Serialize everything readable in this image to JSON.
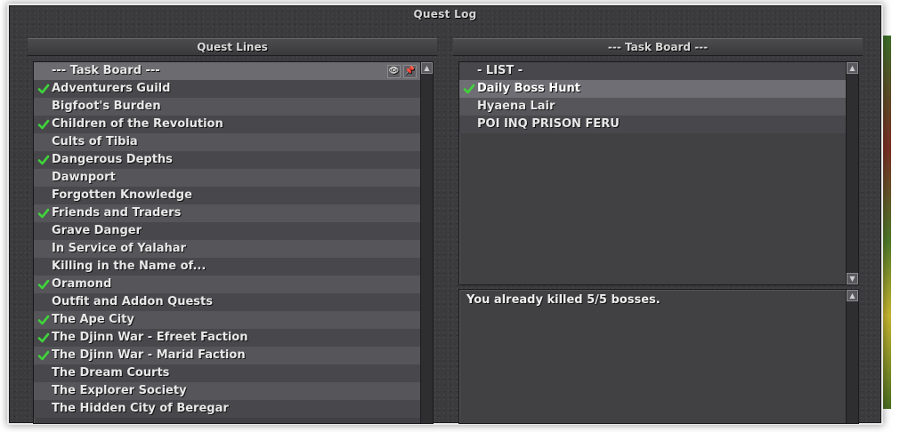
{
  "window": {
    "title": "Quest Log"
  },
  "left_panel": {
    "title": "Quest Lines",
    "header_row": "--- Task Board ---",
    "tools": {
      "eye_glyph": "👁",
      "pin_glyph": "📌"
    },
    "items": [
      {
        "label": "Adventurers Guild",
        "completed": true
      },
      {
        "label": "Bigfoot's Burden",
        "completed": false
      },
      {
        "label": "Children of the Revolution",
        "completed": true
      },
      {
        "label": "Cults of Tibia",
        "completed": false
      },
      {
        "label": "Dangerous Depths",
        "completed": true
      },
      {
        "label": "Dawnport",
        "completed": false
      },
      {
        "label": "Forgotten Knowledge",
        "completed": false
      },
      {
        "label": "Friends and Traders",
        "completed": true
      },
      {
        "label": "Grave Danger",
        "completed": false
      },
      {
        "label": "In Service of Yalahar",
        "completed": false
      },
      {
        "label": "Killing in the Name of...",
        "completed": false
      },
      {
        "label": "Oramond",
        "completed": true
      },
      {
        "label": "Outfit and Addon Quests",
        "completed": false
      },
      {
        "label": "The Ape City",
        "completed": true
      },
      {
        "label": "The Djinn War - Efreet Faction",
        "completed": true
      },
      {
        "label": "The Djinn War - Marid Faction",
        "completed": true
      },
      {
        "label": "The Dream Courts",
        "completed": false
      },
      {
        "label": "The Explorer Society",
        "completed": false
      },
      {
        "label": "The Hidden City of Beregar",
        "completed": false
      }
    ]
  },
  "right_panel": {
    "title": "--- Task Board ---",
    "header_row": "- LIST -",
    "items": [
      {
        "label": "Daily Boss Hunt",
        "completed": true,
        "selected": true
      },
      {
        "label": "Hyaena Lair",
        "completed": false,
        "selected": false
      },
      {
        "label": "POI INQ PRISON FERU",
        "completed": false,
        "selected": false
      }
    ],
    "detail_text": "You already killed 5/5 bosses."
  },
  "colors": {
    "check": "#3fd43a",
    "panel_bg": "#414144",
    "row_odd": "#55555a",
    "row_even": "#48484c"
  },
  "icons": {
    "check": "checkmark-icon",
    "scroll_up": "arrow-up-icon",
    "scroll_down": "arrow-down-icon"
  }
}
